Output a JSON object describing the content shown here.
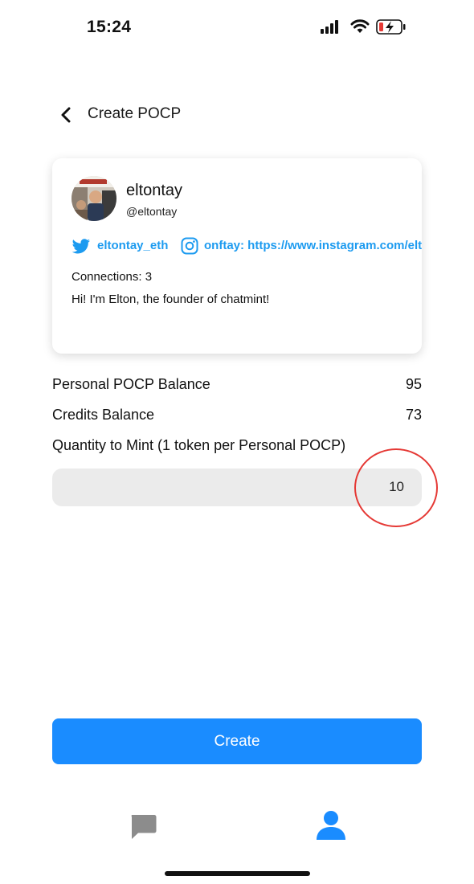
{
  "status_bar": {
    "time": "15:24",
    "icons": [
      "signal-icon",
      "wifi-icon",
      "battery-charging-icon"
    ]
  },
  "nav": {
    "back_icon": "chevron-left-icon",
    "title": "Create POCP"
  },
  "profile": {
    "name": "eltontay",
    "handle": "@eltontay",
    "twitter": "eltontay_eth",
    "instagram": "onftay: https://www.instagram.com/elton",
    "connections": "Connections: 3",
    "bio": "Hi! I'm Elton, the founder of chatmint!"
  },
  "balances": {
    "personal_label": "Personal POCP Balance",
    "personal_value": "95",
    "credits_label": "Credits Balance",
    "credits_value": "73"
  },
  "mint": {
    "label": "Quantity to Mint (1 token per Personal POCP)",
    "quantity": "10"
  },
  "actions": {
    "create_label": "Create"
  },
  "tabbar": {
    "items": [
      {
        "icon": "chat-bubble-icon",
        "active": false
      },
      {
        "icon": "person-icon",
        "active": true
      }
    ]
  },
  "colors": {
    "accent": "#1a8cff",
    "link": "#1d9bf0",
    "highlight": "#e53935",
    "inactive_tab": "#8c8c8c"
  }
}
